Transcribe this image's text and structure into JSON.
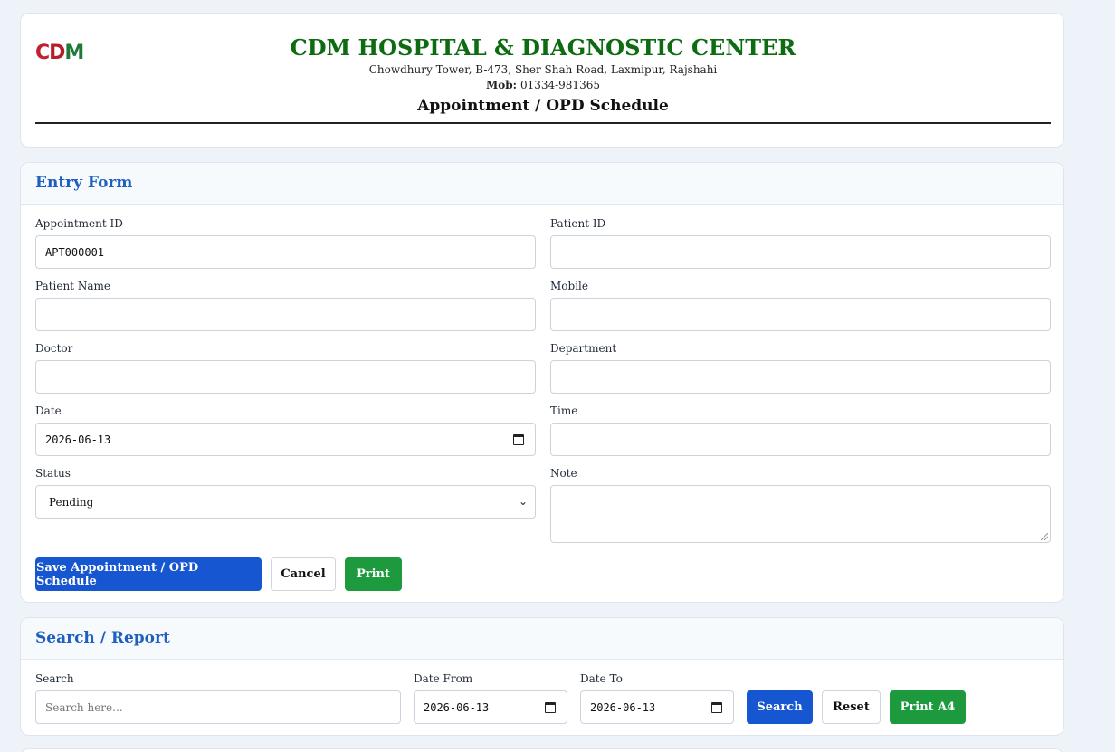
{
  "header": {
    "logo": {
      "c": "C",
      "d": "D",
      "m": "M"
    },
    "hospital_name": "CDM HOSPITAL & DIAGNOSTIC CENTER",
    "address": "Chowdhury Tower, B-473, Sher Shah Road, Laxmipur, Rajshahi",
    "mob_label": "Mob:",
    "mob_value": "01334-981365",
    "page_title": "Appointment / OPD Schedule"
  },
  "entry_form": {
    "title": "Entry Form",
    "appointment_id": {
      "label": "Appointment ID",
      "value": "APT000001"
    },
    "patient_id": {
      "label": "Patient ID",
      "value": ""
    },
    "patient_name": {
      "label": "Patient Name",
      "value": ""
    },
    "mobile": {
      "label": "Mobile",
      "value": ""
    },
    "doctor": {
      "label": "Doctor",
      "value": ""
    },
    "department": {
      "label": "Department",
      "value": ""
    },
    "date": {
      "label": "Date",
      "value": "2026-06-13"
    },
    "time": {
      "label": "Time",
      "value": ""
    },
    "status": {
      "label": "Status",
      "value": "Pending"
    },
    "note": {
      "label": "Note",
      "value": ""
    },
    "buttons": {
      "save": "Save Appointment / OPD Schedule",
      "cancel": "Cancel",
      "print": "Print"
    }
  },
  "search_report": {
    "title": "Search / Report",
    "search": {
      "label": "Search",
      "placeholder": "Search here..."
    },
    "date_from": {
      "label": "Date From",
      "value": "2026-06-13"
    },
    "date_to": {
      "label": "Date To",
      "value": "2026-06-13"
    },
    "buttons": {
      "search": "Search",
      "reset": "Reset",
      "print_a4": "Print A4"
    }
  },
  "colors": {
    "brand_green": "#0d6b12",
    "accent_blue": "#1e5fbf",
    "button_blue": "#1756d1",
    "button_green": "#1c9a3d"
  }
}
